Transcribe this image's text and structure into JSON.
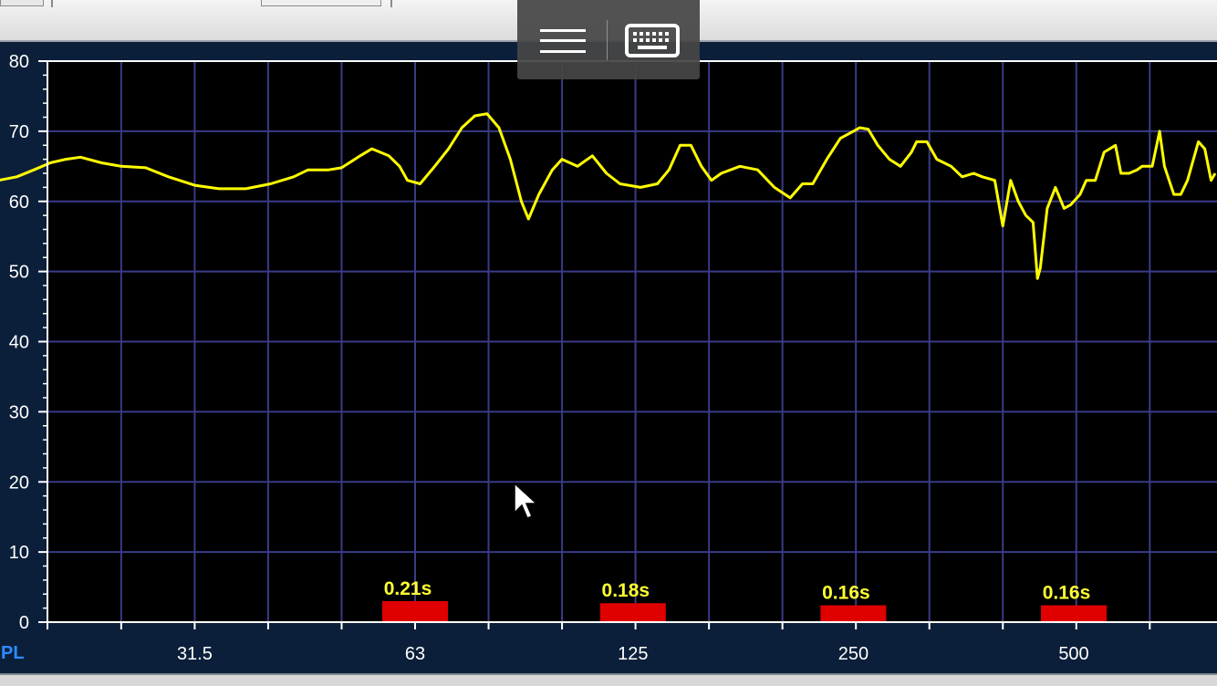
{
  "toolbar": {
    "menu_icon": "hamburger-menu-icon",
    "keyboard_icon": "keyboard-icon"
  },
  "colors": {
    "plot_bg": "#000000",
    "frame_bg": "#0b1f3a",
    "grid": "#3a3a8a",
    "curve": "#ffff00",
    "bar": "#e00000",
    "bar_label": "#ffff33",
    "tick_text": "#ffffff",
    "series_label": "#2d8cff"
  },
  "chart_data": {
    "type": "line",
    "x_scale": "log",
    "ylim": [
      0,
      80
    ],
    "y_ticks": [
      0,
      10,
      20,
      30,
      40,
      50,
      60,
      70,
      80
    ],
    "x_tick_labels": [
      {
        "x": 31.5,
        "label": "31.5"
      },
      {
        "x": 63,
        "label": "63"
      },
      {
        "x": 125,
        "label": "125"
      },
      {
        "x": 250,
        "label": "250"
      },
      {
        "x": 500,
        "label": "500"
      }
    ],
    "grid": true,
    "series_label": "PL",
    "series": [
      {
        "points": [
          [
            16,
            62.3
          ],
          [
            17,
            63
          ],
          [
            18,
            63.5
          ],
          [
            19,
            64.5
          ],
          [
            20,
            65.5
          ],
          [
            21,
            66
          ],
          [
            22,
            66.3
          ],
          [
            23.5,
            65.5
          ],
          [
            25,
            65
          ],
          [
            27,
            64.8
          ],
          [
            29,
            63.5
          ],
          [
            31.5,
            62.3
          ],
          [
            34,
            61.8
          ],
          [
            37,
            61.8
          ],
          [
            40,
            62.5
          ],
          [
            43,
            63.5
          ],
          [
            45,
            64.5
          ],
          [
            48,
            64.5
          ],
          [
            50,
            64.8
          ],
          [
            53,
            66.5
          ],
          [
            55,
            67.5
          ],
          [
            58,
            66.5
          ],
          [
            60,
            65
          ],
          [
            61.5,
            63
          ],
          [
            64,
            62.5
          ],
          [
            67,
            65
          ],
          [
            70,
            67.5
          ],
          [
            73,
            70.5
          ],
          [
            76,
            72.2
          ],
          [
            79,
            72.5
          ],
          [
            82,
            70.5
          ],
          [
            85,
            66
          ],
          [
            88,
            60
          ],
          [
            90,
            57.5
          ],
          [
            93,
            61
          ],
          [
            97,
            64.5
          ],
          [
            100,
            66
          ],
          [
            105,
            65
          ],
          [
            110,
            66.5
          ],
          [
            115,
            64
          ],
          [
            120,
            62.5
          ],
          [
            128,
            62
          ],
          [
            135,
            62.5
          ],
          [
            140,
            64.5
          ],
          [
            145,
            68
          ],
          [
            150,
            68
          ],
          [
            155,
            65
          ],
          [
            160,
            63
          ],
          [
            165,
            64
          ],
          [
            175,
            65
          ],
          [
            185,
            64.5
          ],
          [
            195,
            62
          ],
          [
            205,
            60.5
          ],
          [
            213,
            62.5
          ],
          [
            220,
            62.5
          ],
          [
            230,
            66
          ],
          [
            240,
            69
          ],
          [
            250,
            70
          ],
          [
            255,
            70.5
          ],
          [
            262,
            70.3
          ],
          [
            270,
            68
          ],
          [
            280,
            66
          ],
          [
            290,
            65
          ],
          [
            300,
            67
          ],
          [
            305,
            68.5
          ],
          [
            315,
            68.5
          ],
          [
            325,
            66
          ],
          [
            340,
            65
          ],
          [
            352,
            63.5
          ],
          [
            365,
            64
          ],
          [
            375,
            63.5
          ],
          [
            390,
            63
          ],
          [
            400,
            56.5
          ],
          [
            410,
            63
          ],
          [
            420,
            60
          ],
          [
            430,
            58
          ],
          [
            440,
            57
          ],
          [
            446,
            49
          ],
          [
            450,
            50.5
          ],
          [
            460,
            59
          ],
          [
            472,
            62
          ],
          [
            485,
            59
          ],
          [
            495,
            59.5
          ],
          [
            510,
            61
          ],
          [
            520,
            63
          ],
          [
            535,
            63
          ],
          [
            550,
            67
          ],
          [
            570,
            68
          ],
          [
            580,
            64
          ],
          [
            595,
            64
          ],
          [
            610,
            64.5
          ],
          [
            620,
            65
          ],
          [
            640,
            65
          ],
          [
            655,
            70
          ],
          [
            665,
            65
          ],
          [
            685,
            61
          ],
          [
            700,
            61
          ],
          [
            715,
            63
          ],
          [
            740,
            68.5
          ],
          [
            755,
            67.5
          ],
          [
            770,
            63
          ],
          [
            780,
            64
          ]
        ]
      }
    ],
    "bars": [
      {
        "x": 63,
        "value": 3.0,
        "label": "0.21s"
      },
      {
        "x": 125,
        "value": 2.7,
        "label": "0.18s"
      },
      {
        "x": 250,
        "value": 2.4,
        "label": "0.16s"
      },
      {
        "x": 500,
        "value": 2.4,
        "label": "0.16s"
      }
    ]
  }
}
